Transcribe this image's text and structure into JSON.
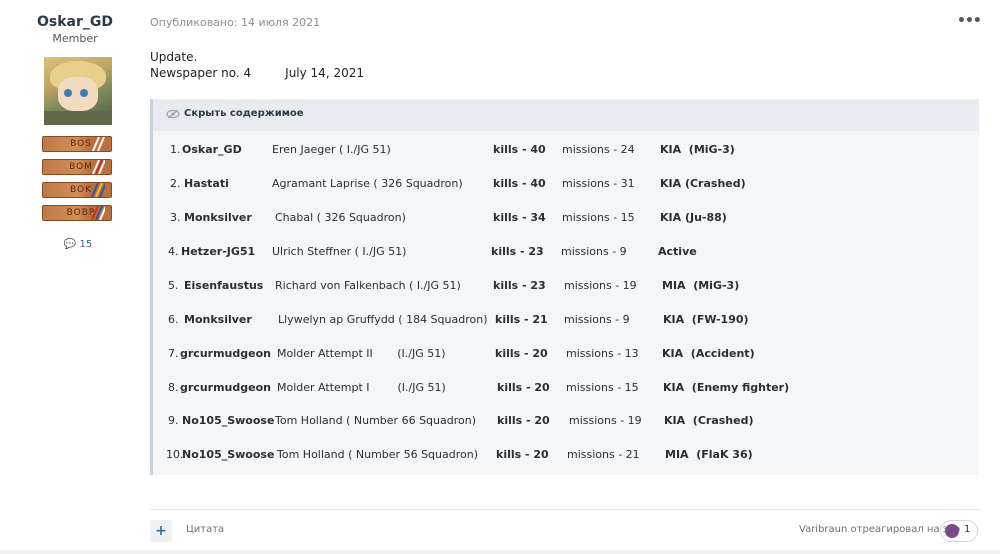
{
  "author": {
    "name": "Oskar_GD",
    "role": "Member",
    "badges": [
      "BOS",
      "BOM",
      "BOK",
      "BOBP"
    ],
    "posts": "15"
  },
  "post": {
    "meta": "Опубликовано: 14 июля 2021",
    "line1": "Update.",
    "line2a": "Newspaper no. 4",
    "line2b": "July 14, 2021",
    "spoiler_label": "Скрыть содержимое",
    "rows": [
      {
        "num": "1.",
        "nick": "Oskar_GD",
        "pilot": "Eren Jaeger ( I./JG 51)",
        "kills": "kills - 40",
        "missions": "missions - 24",
        "status": "KIA  (MiG-3)"
      },
      {
        "num": "2.",
        "nick": "Hastati",
        "pilot": "Agramant Laprise ( 326 Squadron)",
        "kills": "kills - 40",
        "missions": "missions - 31",
        "status": "KIA (Crashed)"
      },
      {
        "num": "3.",
        "nick": "Monksilver",
        "pilot": "Chabal ( 326 Squadron)",
        "kills": "kills - 34",
        "missions": "missions - 15",
        "status": "KIA (Ju-88)"
      },
      {
        "num": "4.",
        "nick": "Hetzer-JG51",
        "pilot": "Ulrich Steffner ( I./JG 51)",
        "kills": "kills - 23",
        "missions": "missions - 9",
        "status": "Active"
      },
      {
        "num": "5.",
        "nick": "Eisenfaustus",
        "pilot": "Richard von Falkenbach ( I./JG 51)",
        "kills": "kills - 23",
        "missions": "missions - 19",
        "status": "MIA  (MiG-3)"
      },
      {
        "num": "6.",
        "nick": "Monksilver",
        "pilot": "Llywelyn ap Gruffydd ( 184 Squadron)",
        "kills": "kills - 21",
        "missions": "missions - 9",
        "status": "KIA  (FW-190)"
      },
      {
        "num": "7.",
        "nick": "grcurmudgeon",
        "pilot": "Molder Attempt II       (I./JG 51)",
        "kills": "kills - 20",
        "missions": "missions - 13",
        "status": "KIA  (Accident)"
      },
      {
        "num": "8.",
        "nick": "grcurmudgeon",
        "pilot": "Molder Attempt I        (I./JG 51)",
        "kills": "kills - 20",
        "missions": "missions - 15",
        "status": "KIA  (Enemy fighter)"
      },
      {
        "num": "9.",
        "nick": "No105_Swoose",
        "pilot": "Tom Holland ( Number 66 Squadron)",
        "kills": "kills - 20",
        "missions": "missions - 19",
        "status": "KIA  (Crashed)"
      },
      {
        "num": "10.",
        "nick": "No105_Swoose",
        "pilot": "Tom Holland ( Number 56 Squadron)",
        "kills": "kills - 20",
        "missions": "missions - 21",
        "status": "MIA  (FlaK 36)"
      }
    ]
  },
  "footer": {
    "plus": "+",
    "quote": "Цитата",
    "reaction_text": "Varibraun отреагировал на это",
    "reaction_count": "1"
  },
  "colors": {
    "accent": "#3a6d9a",
    "spoiler_bg": "#f4f6f8",
    "badge": "#c07a47"
  }
}
